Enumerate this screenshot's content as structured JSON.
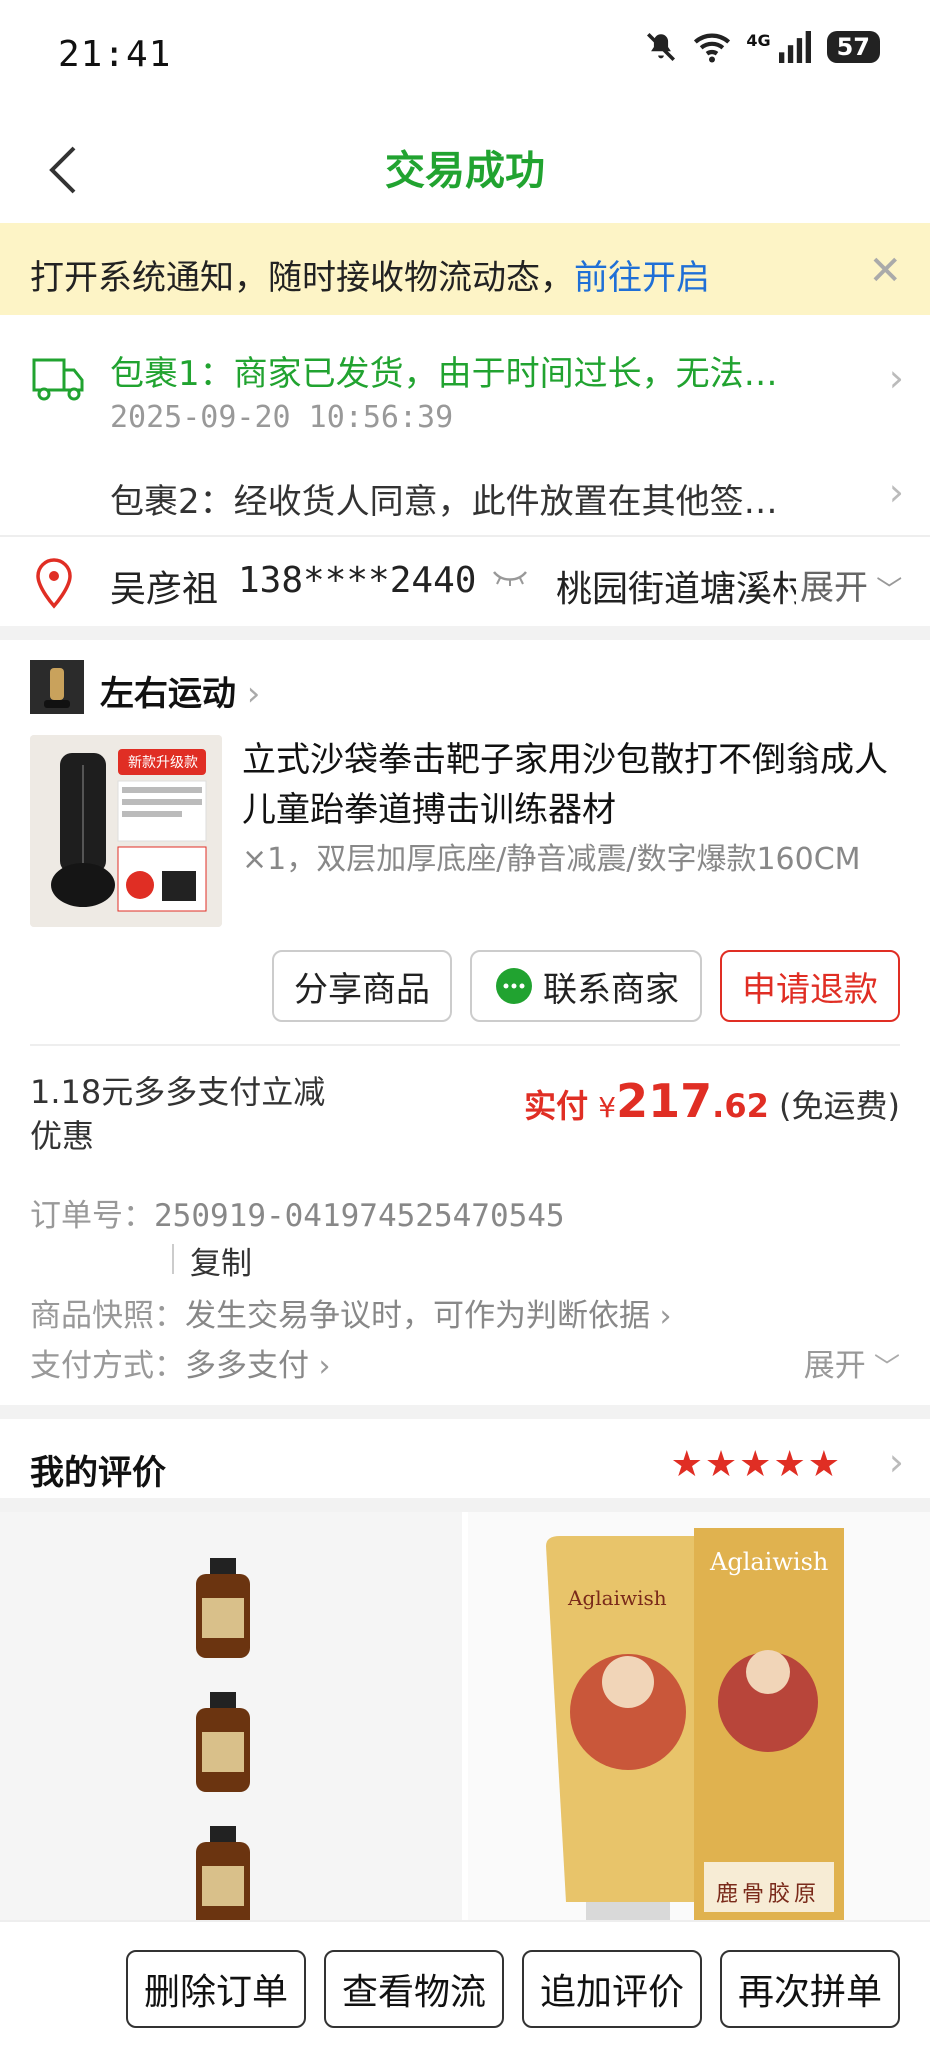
{
  "status": {
    "time": "21:41",
    "network": "4G",
    "battery": "57"
  },
  "nav": {
    "title": "交易成功"
  },
  "notice": {
    "text": "打开系统通知，随时接收物流动态，",
    "link": "前往开启"
  },
  "packages": [
    {
      "title": "包裹1：商家已发货，由于时间过长，无法…",
      "time": "2025-09-20 10:56:39"
    },
    {
      "title": "包裹2：经收货人同意，此件放置在其他签…"
    }
  ],
  "address": {
    "name": "吴彦祖",
    "phone": "138****2440",
    "street": "桃园街道塘溪村",
    "expand": "展开"
  },
  "shop": {
    "name": "左右运动"
  },
  "product": {
    "title": "立式沙袋拳击靶子家用沙包散打不倒翁成人儿童跆拳道搏击训练器材",
    "spec": "×1，双层加厚底座/静音减震/数字爆款160CM",
    "img_badge": "新款升级款"
  },
  "actions": {
    "share": "分享商品",
    "contact": "联系商家",
    "refund": "申请退款"
  },
  "payment": {
    "discount": "1.18元多多支付立减优惠",
    "label": "实付",
    "currency": "¥",
    "amount_int": "217",
    "amount_dec": ".62",
    "shipping": "(免运费)"
  },
  "order": {
    "id_label": "订单号：",
    "id": "250919-041974525470545",
    "copy": "复制",
    "snapshot_label": "商品快照：",
    "snapshot_val": "发生交易争议时，可作为判断依据",
    "paymethod_label": "支付方式：",
    "paymethod_val": "多多支付",
    "expand": "展开"
  },
  "review": {
    "title": "我的评价",
    "stars": "★★★★★"
  },
  "gallery": {
    "right_brand": "Aglaiwish",
    "right_box_text": "鹿骨胶原"
  },
  "bottom": {
    "delete": "删除订单",
    "logistics": "查看物流",
    "add_review": "追加评价",
    "regroup": "再次拼单"
  }
}
